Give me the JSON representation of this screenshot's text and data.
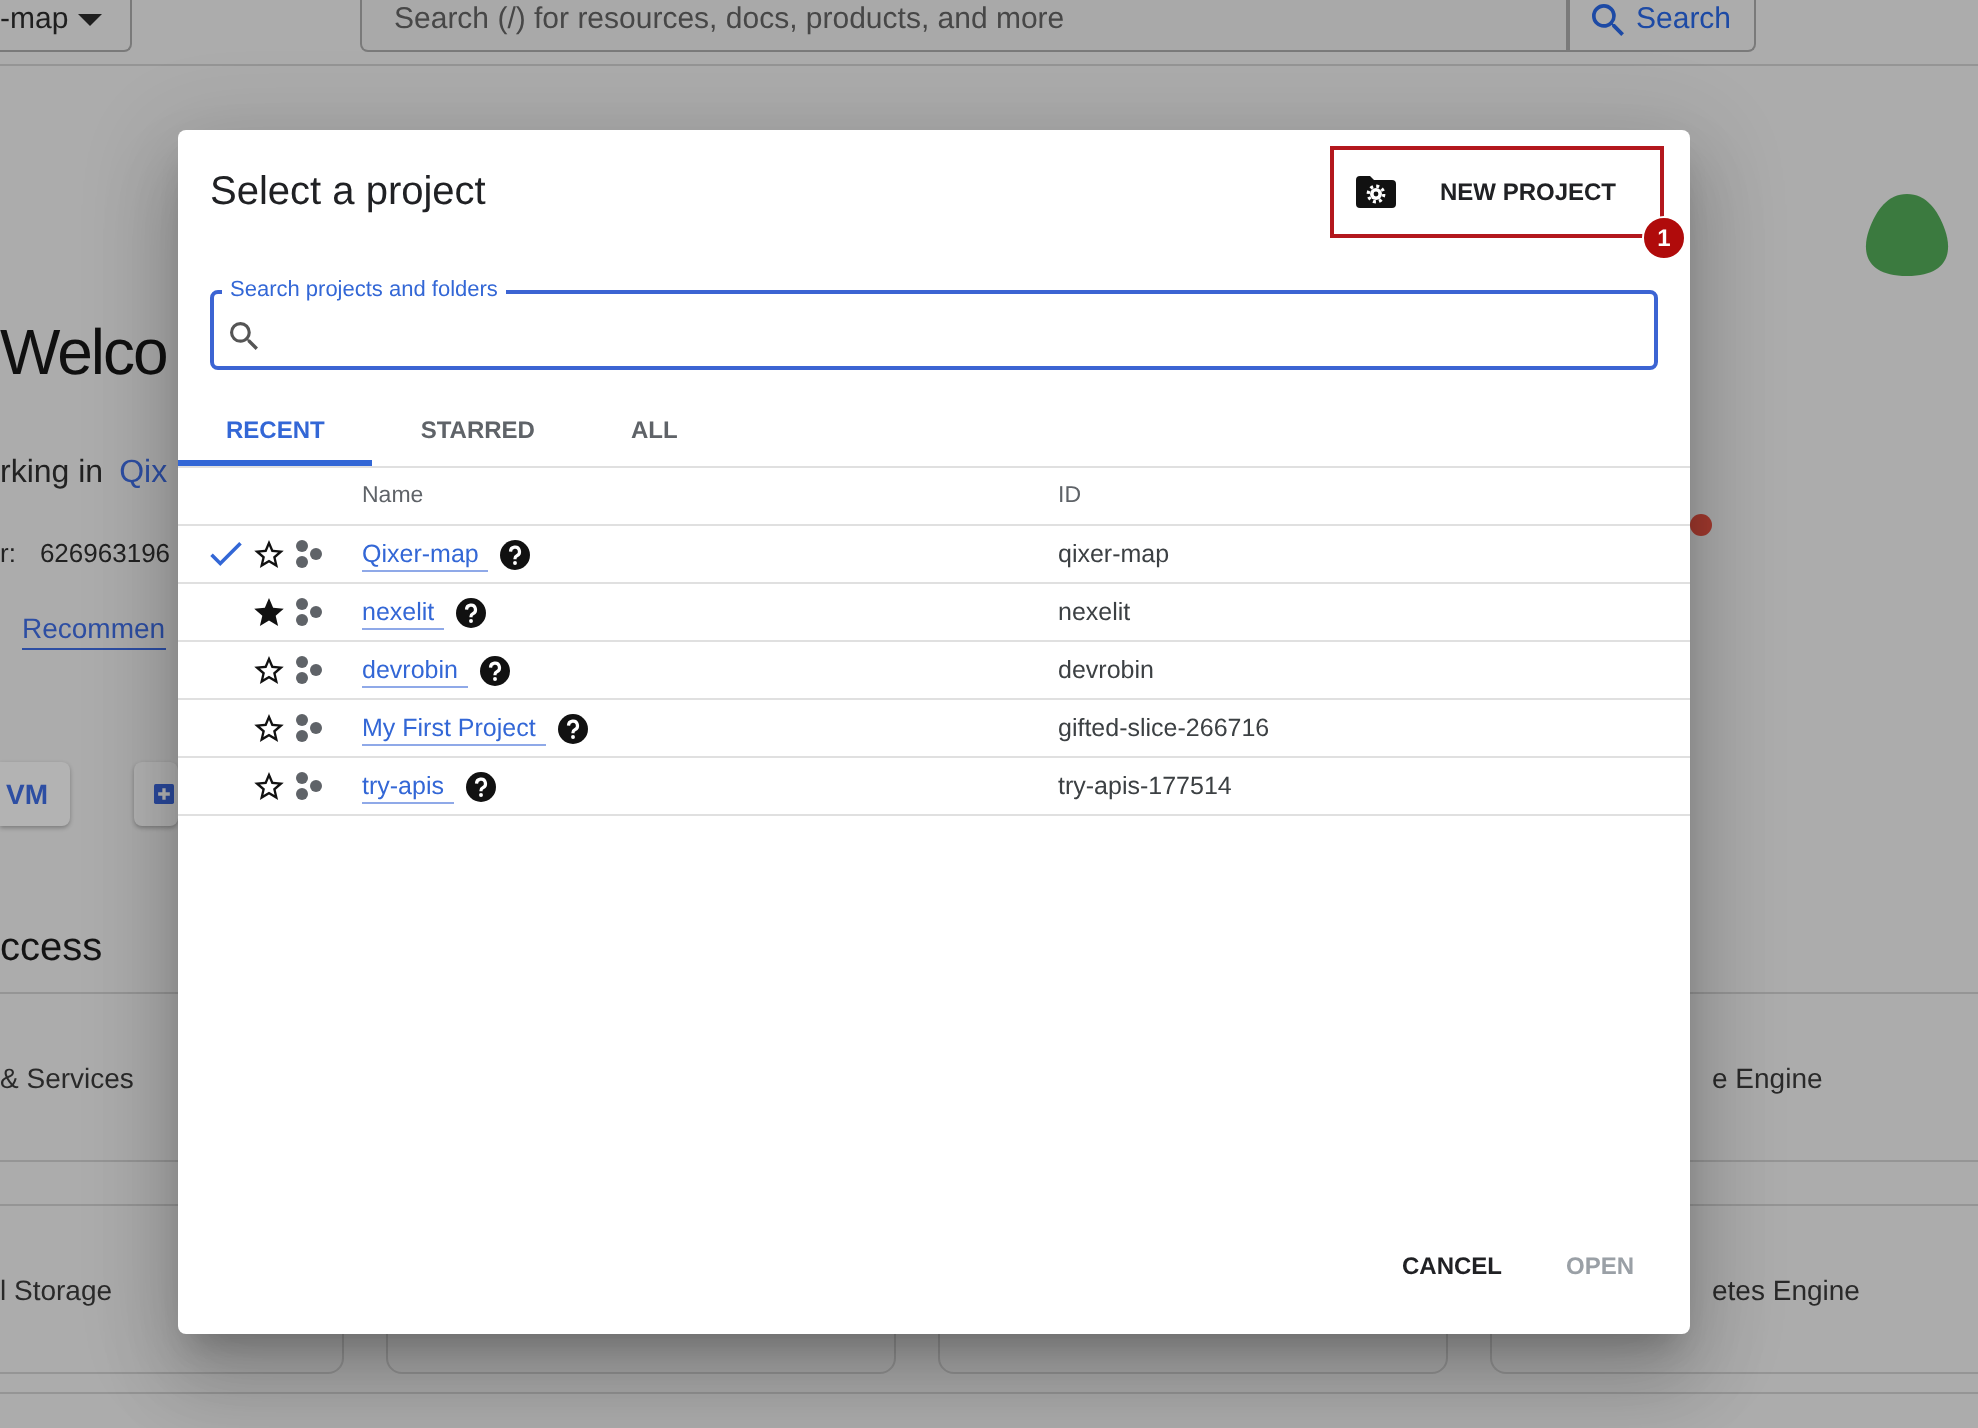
{
  "top_bar": {
    "project_selector": "-map",
    "search": {
      "placeholder": "Search (/) for resources, docs, products, and more"
    },
    "search_button": "Search"
  },
  "welcome": {
    "heading": "Welco",
    "working_in": "rking in",
    "project_link": "Qix",
    "project_number_label": "r:",
    "project_number": "626963196",
    "recommendations_link": "Recommen",
    "action_buttons": [
      {
        "kind": "text",
        "label": "VM"
      },
      {
        "kind": "icon"
      }
    ]
  },
  "quick_access": {
    "title": "ccess",
    "card_rows": [
      {
        "left": "& Services",
        "right": "e Engine"
      },
      {
        "left": "l Storage",
        "right": "etes Engine"
      }
    ]
  },
  "dialog": {
    "title": "Select a project",
    "new_project_button": "NEW PROJECT",
    "annotation_badge": "1",
    "search": {
      "label": "Search projects and folders"
    },
    "tabs": [
      {
        "label": "RECENT",
        "selected": true
      },
      {
        "label": "STARRED",
        "selected": false
      },
      {
        "label": "ALL",
        "selected": false
      }
    ],
    "table": {
      "columns": [
        "Name",
        "ID"
      ],
      "rows": [
        {
          "name": "Qixer-map",
          "id": "qixer-map",
          "selected": true,
          "starred": false
        },
        {
          "name": "nexelit",
          "id": "nexelit",
          "selected": false,
          "starred": true
        },
        {
          "name": "devrobin",
          "id": "devrobin",
          "selected": false,
          "starred": false
        },
        {
          "name": "My First Project",
          "id": "gifted-slice-266716",
          "selected": false,
          "starred": false
        },
        {
          "name": "try-apis",
          "id": "try-apis-177514",
          "selected": false,
          "starred": false
        }
      ]
    },
    "buttons": [
      {
        "label": "CANCEL",
        "disabled": false
      },
      {
        "label": "OPEN",
        "disabled": true
      }
    ]
  }
}
